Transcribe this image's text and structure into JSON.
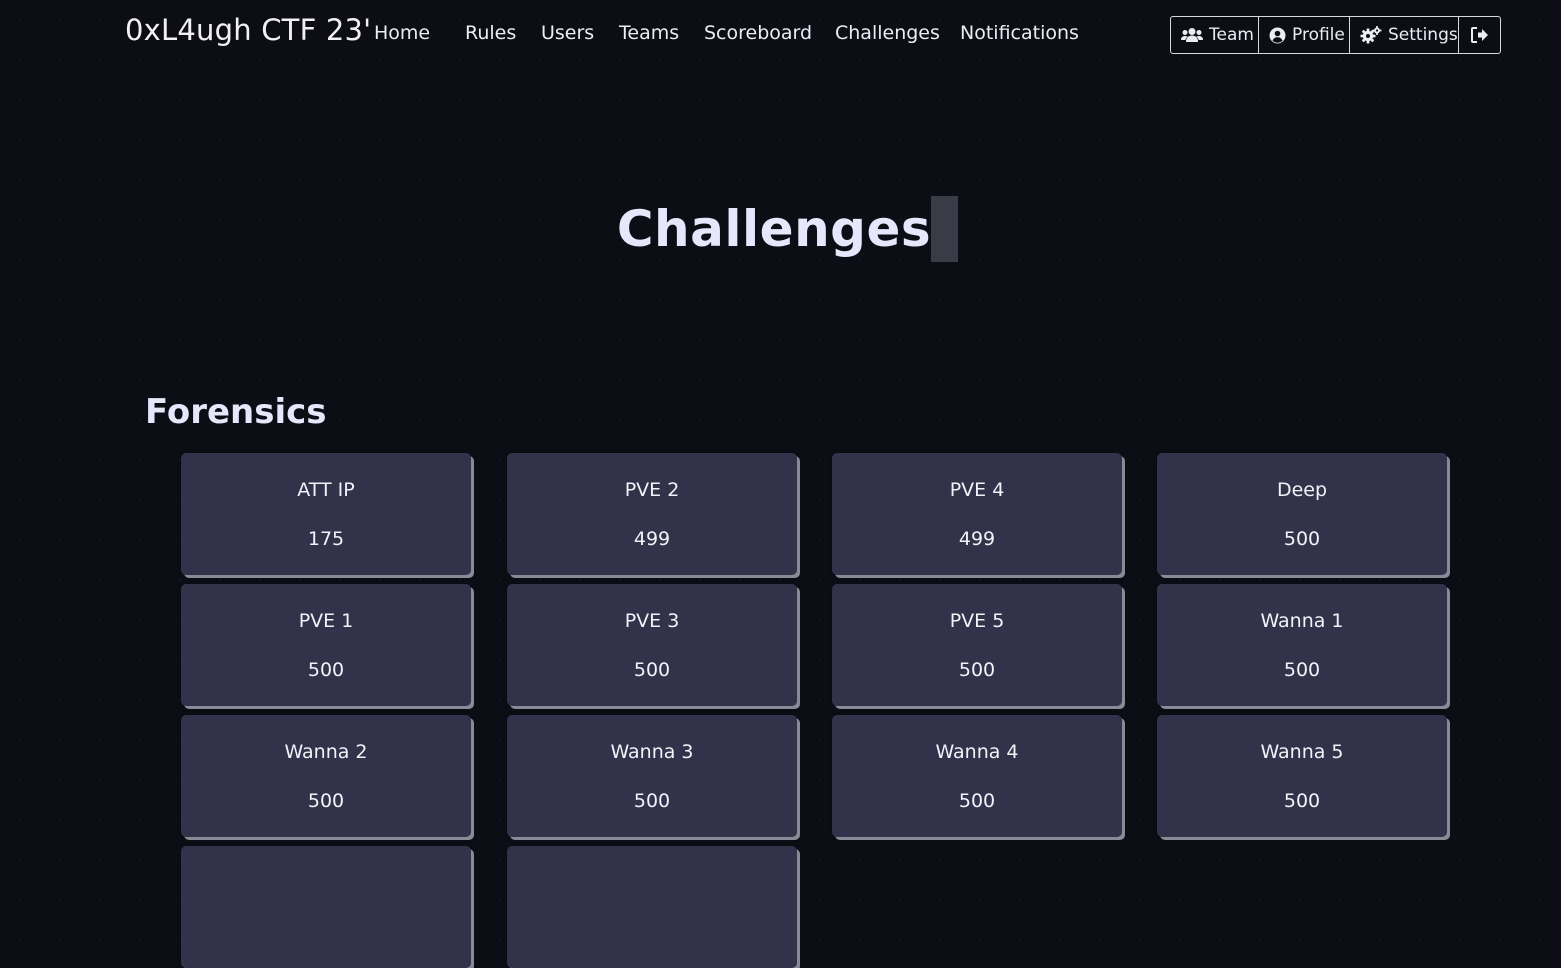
{
  "brand": "0xL4ugh CTF 23'",
  "nav": {
    "links": [
      "Home",
      "Rules",
      "Users",
      "Teams",
      "Scoreboard",
      "Challenges",
      "Notifications"
    ],
    "right": {
      "team_label": "Team",
      "profile_label": "Profile",
      "settings_label": "Settings"
    }
  },
  "page": {
    "title": "Challenges"
  },
  "categories": [
    {
      "name": "Forensics",
      "challenges": [
        {
          "name": "ATT IP",
          "points": "175"
        },
        {
          "name": "PVE 2",
          "points": "499"
        },
        {
          "name": "PVE 4",
          "points": "499"
        },
        {
          "name": "Deep",
          "points": "500"
        },
        {
          "name": "PVE 1",
          "points": "500"
        },
        {
          "name": "PVE 3",
          "points": "500"
        },
        {
          "name": "PVE 5",
          "points": "500"
        },
        {
          "name": "Wanna 1",
          "points": "500"
        },
        {
          "name": "Wanna 2",
          "points": "500"
        },
        {
          "name": "Wanna 3",
          "points": "500"
        },
        {
          "name": "Wanna 4",
          "points": "500"
        },
        {
          "name": "Wanna 5",
          "points": "500"
        }
      ]
    }
  ],
  "colors": {
    "background": "#0d0d16",
    "card": "#32324a",
    "title": "#e8e6fa"
  },
  "icons": {
    "team": "users-icon",
    "profile": "user-circle-icon",
    "settings": "gears-icon",
    "logout": "sign-out-icon"
  }
}
